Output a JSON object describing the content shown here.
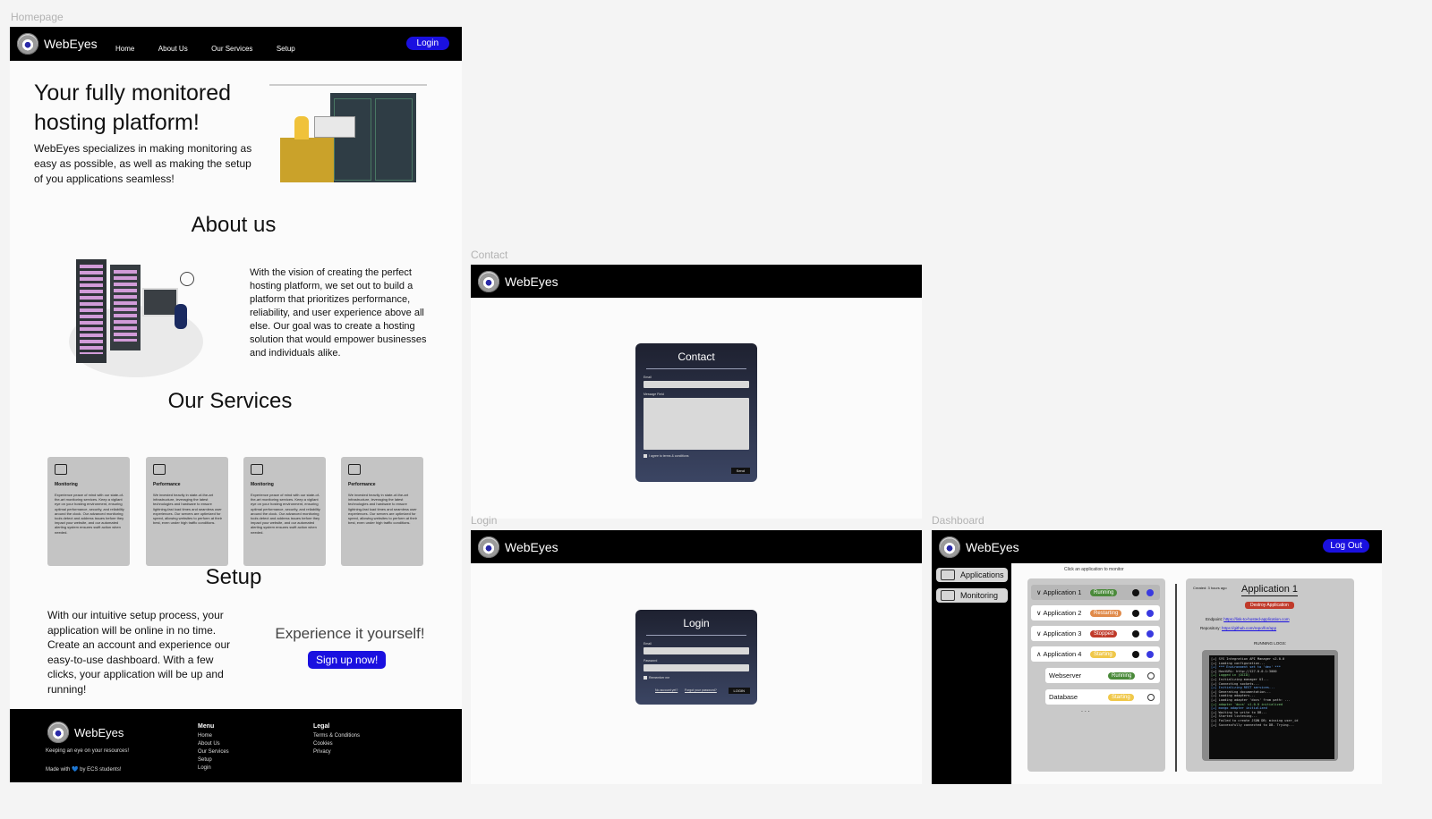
{
  "frames": {
    "homepage": "Homepage",
    "contact": "Contact",
    "login": "Login",
    "dashboard": "Dashboard"
  },
  "brand": {
    "name": "WebEyes"
  },
  "colors": {
    "accent": "#1a10e0",
    "running": "#4a8a3a",
    "restarting": "#e08a4a",
    "stopped": "#c03a2a",
    "starting": "#f0c84a"
  },
  "homepage": {
    "nav": [
      "Home",
      "About Us",
      "Our Services",
      "Setup"
    ],
    "login_label": "Login",
    "hero_title": "Your fully monitored hosting platform!",
    "hero_text": "WebEyes specializes in making monitoring as easy as possible, as well as making the setup of you applications seamless!",
    "about_title": "About us",
    "about_text": "With the vision of creating the perfect hosting platform, we set out to build a platform that prioritizes performance, reliability, and user experience above all else. Our goal was to create a hosting solution that would empower businesses and individuals alike.",
    "services_title": "Our Services",
    "services": [
      {
        "icon": "monitoring-icon",
        "title": "Monitoring",
        "text": "Experience peace of mind with our state-of-the-art monitoring services. Keep a vigilant eye on your hosting environment, ensuring optimal performance, security, and reliability around the clock. Our advanced monitoring tools detect and address issues before they impact your website, and our automated alerting system ensures swift action when needed."
      },
      {
        "icon": "performance-icon",
        "title": "Performance",
        "text": "We invested heavily in state-of-the-art infrastructure, leveraging the latest technologies and hardware to ensure lightning-fast load times and seamless user experiences. Our servers are optimized for speed, allowing websites to perform at their best, even under high traffic conditions."
      },
      {
        "icon": "monitoring-icon",
        "title": "Monitoring",
        "text": "Experience peace of mind with our state-of-the-art monitoring services. Keep a vigilant eye on your hosting environment, ensuring optimal performance, security, and reliability around the clock. Our advanced monitoring tools detect and address issues before they impact your website, and our automated alerting system ensures swift action when needed."
      },
      {
        "icon": "performance-icon",
        "title": "Performance",
        "text": "We invested heavily in state-of-the-art infrastructure, leveraging the latest technologies and hardware to ensure lightning-fast load times and seamless user experiences. Our servers are optimized for speed, allowing websites to perform at their best, even under high traffic conditions."
      }
    ],
    "setup_title": "Setup",
    "setup_text": "With our intuitive setup process, your application will be online in no time. Create an account and experience our easy-to-use dashboard. With a few clicks, your application will be up and running!",
    "cta_text": "Experience it yourself!",
    "cta_button": "Sign up now!",
    "footer": {
      "tagline": "Keeping an eye on your resources!",
      "made_with": "Made with 💙 by ECS students!",
      "menu_title": "Menu",
      "menu": [
        "Home",
        "About Us",
        "Our Services",
        "Setup",
        "Login"
      ],
      "legal_title": "Legal",
      "legal": [
        "Terms & Conditions",
        "Cookies",
        "Privacy"
      ]
    }
  },
  "contact": {
    "title": "Contact",
    "email_label": "Email",
    "message_label": "Message Field",
    "agree_label": "I agree to terms & conditions",
    "send": "Send"
  },
  "login": {
    "title": "Login",
    "email_label": "Email",
    "password_label": "Password",
    "remember_label": "Remember me",
    "no_account": "No account yet?",
    "forgot": "Forgot your password?",
    "submit": "LOGIN"
  },
  "dashboard": {
    "logout": "Log Out",
    "sidebar": [
      "Applications",
      "Monitoring"
    ],
    "hint": "Click an application to monitor",
    "apps": [
      {
        "name": "Application 1",
        "status": "Running",
        "status_color": "#4a8a3a",
        "expanded": false,
        "selected": true
      },
      {
        "name": "Application 2",
        "status": "Restarting",
        "status_color": "#e08a4a",
        "expanded": false,
        "selected": false
      },
      {
        "name": "Application 3",
        "status": "Stopped",
        "status_color": "#c03a2a",
        "expanded": false,
        "selected": false
      },
      {
        "name": "Application 4",
        "status": "Starting",
        "status_color": "#f0c84a",
        "expanded": true,
        "selected": false
      }
    ],
    "subitems": [
      {
        "name": "Webserver",
        "status": "Running",
        "status_color": "#4a8a3a"
      },
      {
        "name": "Database",
        "status": "Starting",
        "status_color": "#f0c84a"
      }
    ],
    "more": ". . .",
    "detail": {
      "created": "Created: 3 hours ago",
      "title": "Application 1",
      "destroy": "Destroy Application",
      "endpoint_label": "Endpoint:",
      "endpoint_value": "https://link-to-hosted-application.com",
      "repo_label": "Repository:",
      "repo_value": "https://github.com/repo/for/app",
      "logs_title": "RUNNING LOGS:",
      "logs": [
        "[+] SYS Integration API Manager v2.0.0",
        "[+] Loading configuration...",
        "[+] *** Environment set to 'dev' ***",
        "[+] HostURL: http://127.0.0.1:3000",
        "[+] Logged in (OCID)",
        "[+] Initializing manager UI...",
        "[+] Connecting sockets...",
        "[+] Initializing REST services...",
        "[+] Generating documentation...",
        "[+] Loading adapters...",
        "[+] Loading adapter 'docs' from path: ...",
        "[+] adapter 'docs' v1.0.0 initialized",
        "[+] mongo adapter initialized",
        "[+] Waiting to write to DB...",
        "[+] Started listening...",
        "[+] Failed to create JSON DB; missing user_id",
        "[+] Successfully connected to DB. Trying..."
      ]
    }
  }
}
